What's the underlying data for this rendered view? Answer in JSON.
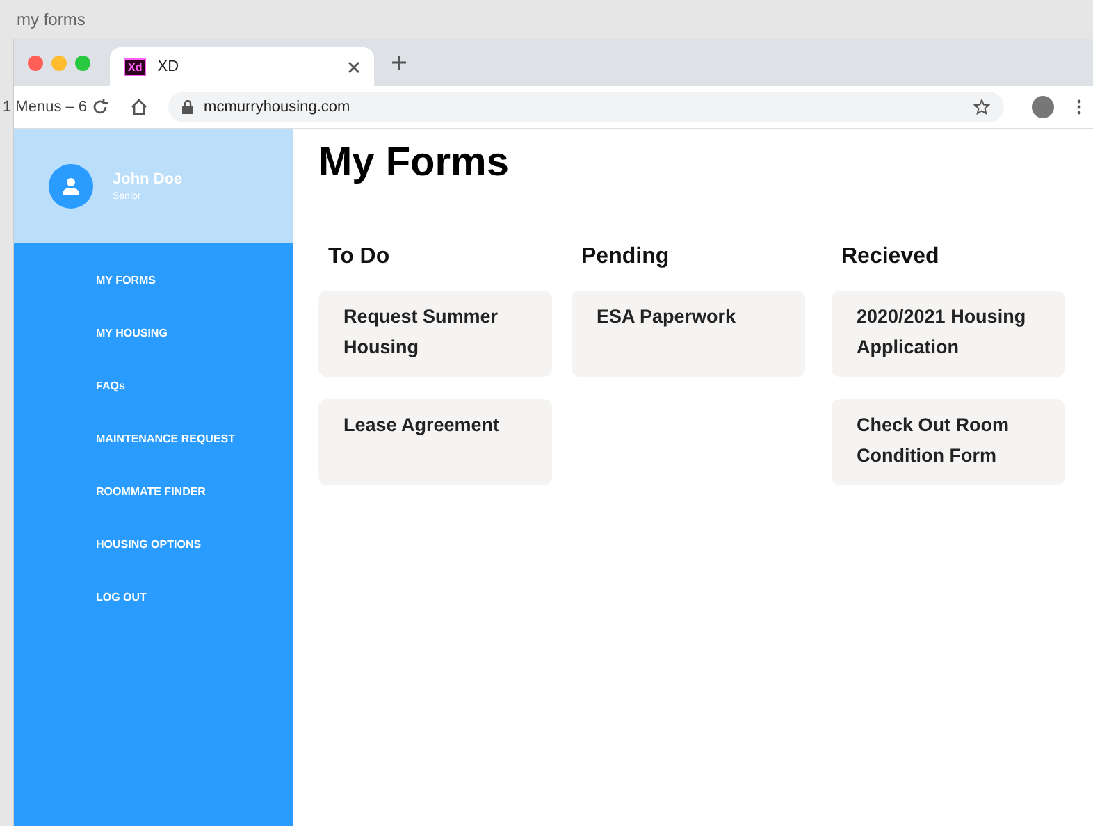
{
  "window": {
    "title": "my forms"
  },
  "browser": {
    "tab": {
      "label": "XD",
      "favicon": "Xd"
    },
    "overlay_text": "1 Menus – 6",
    "url": "mcmurryhousing.com"
  },
  "sidebar": {
    "user": {
      "name": "John Doe",
      "role": "Senior"
    },
    "items": [
      {
        "label": "MY FORMS"
      },
      {
        "label": "MY HOUSING"
      },
      {
        "label": "FAQs"
      },
      {
        "label": "MAINTENANCE REQUEST"
      },
      {
        "label": "ROOMMATE FINDER"
      },
      {
        "label": "HOUSING OPTIONS"
      },
      {
        "label": "LOG OUT"
      }
    ]
  },
  "page": {
    "title": "My Forms",
    "columns": [
      {
        "heading": "To Do",
        "cards": [
          "Request Summer Housing",
          "Lease Agreement"
        ]
      },
      {
        "heading": "Pending",
        "cards": [
          "ESA Paperwork"
        ]
      },
      {
        "heading": "Recieved",
        "cards": [
          "2020/2021 Housing Application",
          "Check Out Room Condition Form"
        ]
      }
    ]
  }
}
